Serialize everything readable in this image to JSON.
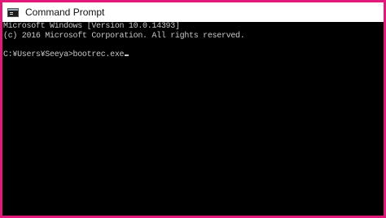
{
  "window": {
    "title": "Command Prompt",
    "icon": "console-app-icon",
    "border_color": "#e0197a"
  },
  "console": {
    "lines": [
      "Microsoft Windows [Version 10.0.14393]",
      "(c) 2016 Microsoft Corporation. All rights reserved.",
      "",
      "C:¥Users¥Seeya>bootrec.exe"
    ],
    "text_color": "#c8c8c8",
    "background": "#000000"
  }
}
